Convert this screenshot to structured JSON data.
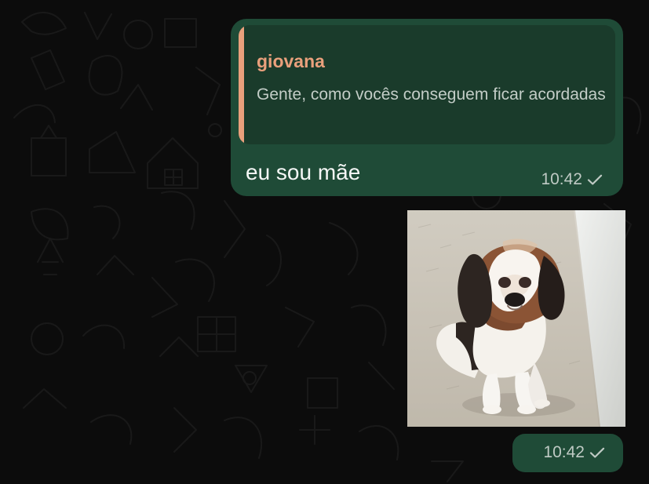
{
  "conversation": {
    "messages": [
      {
        "reply": {
          "author": "giovana",
          "text": "Gente, como vocês conseguem ficar acordadas"
        },
        "text": "eu sou mãe",
        "time": "10:42",
        "status_icon": "single-check-icon"
      },
      {
        "image": {
          "description_icon": "puppy-photo"
        },
        "time": "10:42",
        "status_icon": "single-check-icon"
      }
    ]
  },
  "colors": {
    "background": "#0c0c0c",
    "bubble": "#1f4b37",
    "quote_accent": "#e9a07c",
    "quote_background": "#1a3b2b",
    "meta_text": "#bfcac4"
  }
}
